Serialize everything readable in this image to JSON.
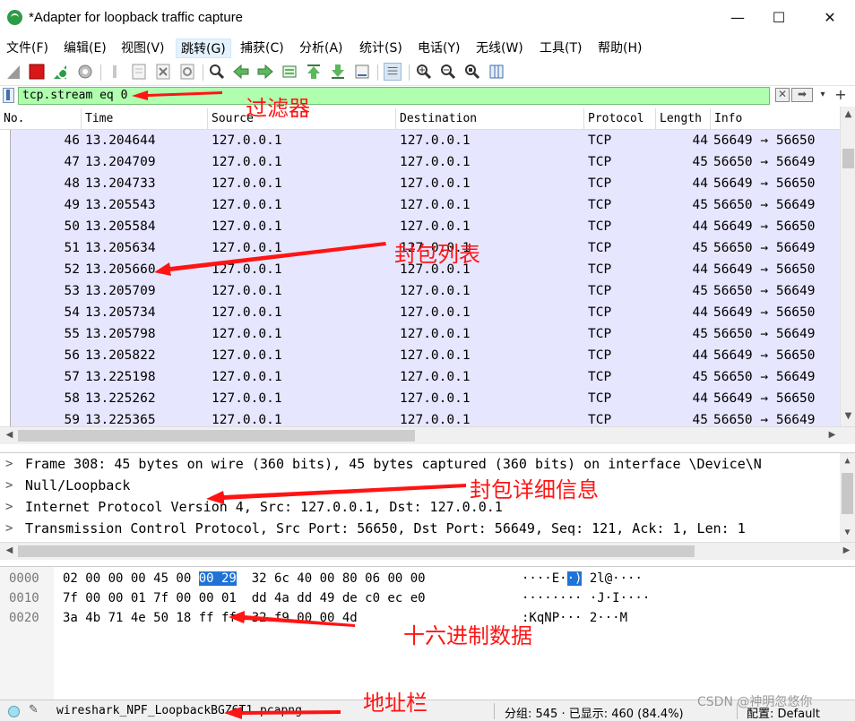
{
  "window": {
    "title": "*Adapter for loopback traffic capture",
    "controls": {
      "minimize": "—",
      "maximize": "☐",
      "close": "✕"
    }
  },
  "menu": {
    "items": [
      "文件(F)",
      "编辑(E)",
      "视图(V)",
      "跳转(G)",
      "捕获(C)",
      "分析(A)",
      "统计(S)",
      "电话(Y)",
      "无线(W)",
      "工具(T)",
      "帮助(H)"
    ],
    "active_index": 3
  },
  "filter": {
    "value": "tcp.stream eq 0",
    "background_color": "#afffaf"
  },
  "packet_list": {
    "columns": [
      "No.",
      "Time",
      "Source",
      "Destination",
      "Protocol",
      "Length",
      "Info"
    ],
    "rows": [
      {
        "no": "46",
        "time": "13.204644",
        "src": "127.0.0.1",
        "dst": "127.0.0.1",
        "proto": "TCP",
        "len": "44",
        "info": "56649 → 56650"
      },
      {
        "no": "47",
        "time": "13.204709",
        "src": "127.0.0.1",
        "dst": "127.0.0.1",
        "proto": "TCP",
        "len": "45",
        "info": "56650 → 56649"
      },
      {
        "no": "48",
        "time": "13.204733",
        "src": "127.0.0.1",
        "dst": "127.0.0.1",
        "proto": "TCP",
        "len": "44",
        "info": "56649 → 56650"
      },
      {
        "no": "49",
        "time": "13.205543",
        "src": "127.0.0.1",
        "dst": "127.0.0.1",
        "proto": "TCP",
        "len": "45",
        "info": "56650 → 56649"
      },
      {
        "no": "50",
        "time": "13.205584",
        "src": "127.0.0.1",
        "dst": "127.0.0.1",
        "proto": "TCP",
        "len": "44",
        "info": "56649 → 56650"
      },
      {
        "no": "51",
        "time": "13.205634",
        "src": "127.0.0.1",
        "dst": "127.0.0.1",
        "proto": "TCP",
        "len": "45",
        "info": "56650 → 56649"
      },
      {
        "no": "52",
        "time": "13.205660",
        "src": "127.0.0.1",
        "dst": "127.0.0.1",
        "proto": "TCP",
        "len": "44",
        "info": "56649 → 56650"
      },
      {
        "no": "53",
        "time": "13.205709",
        "src": "127.0.0.1",
        "dst": "127.0.0.1",
        "proto": "TCP",
        "len": "45",
        "info": "56650 → 56649"
      },
      {
        "no": "54",
        "time": "13.205734",
        "src": "127.0.0.1",
        "dst": "127.0.0.1",
        "proto": "TCP",
        "len": "44",
        "info": "56649 → 56650"
      },
      {
        "no": "55",
        "time": "13.205798",
        "src": "127.0.0.1",
        "dst": "127.0.0.1",
        "proto": "TCP",
        "len": "45",
        "info": "56650 → 56649"
      },
      {
        "no": "56",
        "time": "13.205822",
        "src": "127.0.0.1",
        "dst": "127.0.0.1",
        "proto": "TCP",
        "len": "44",
        "info": "56649 → 56650"
      },
      {
        "no": "57",
        "time": "13.225198",
        "src": "127.0.0.1",
        "dst": "127.0.0.1",
        "proto": "TCP",
        "len": "45",
        "info": "56650 → 56649"
      },
      {
        "no": "58",
        "time": "13.225262",
        "src": "127.0.0.1",
        "dst": "127.0.0.1",
        "proto": "TCP",
        "len": "44",
        "info": "56649 → 56650"
      },
      {
        "no": "59",
        "time": "13.225365",
        "src": "127.0.0.1",
        "dst": "127.0.0.1",
        "proto": "TCP",
        "len": "45",
        "info": "56650 → 56649"
      }
    ],
    "row_background": "#e7e6ff"
  },
  "details": [
    "Frame 308: 45 bytes on wire (360 bits), 45 bytes captured (360 bits) on interface \\Device\\N",
    "Null/Loopback",
    "Internet Protocol Version 4, Src: 127.0.0.1, Dst: 127.0.0.1",
    "Transmission Control Protocol, Src Port: 56650, Dst Port: 56649, Seq: 121, Ack: 1, Len: 1"
  ],
  "hex": {
    "rows": [
      {
        "offset": "0000",
        "bytes_a": "02 00 00 00 45 00 ",
        "bytes_hl": "00 29",
        "bytes_b": "  32 6c 40 00 80 06 00 00",
        "ascii_a": "····E·",
        "ascii_hl": "·)",
        "ascii_b": " 2l@····"
      },
      {
        "offset": "0010",
        "bytes_a": "7f 00 00 01 7f 00 00 01  dd 4a dd 49 de c0 ec e0",
        "bytes_hl": "",
        "bytes_b": "",
        "ascii_a": "········ ·J·I····",
        "ascii_hl": "",
        "ascii_b": ""
      },
      {
        "offset": "0020",
        "bytes_a": "3a 4b 71 4e 50 18 ff ff  32 f9 00 00 4d",
        "bytes_hl": "",
        "bytes_b": "",
        "ascii_a": ":KqNP··· 2···M",
        "ascii_hl": "",
        "ascii_b": ""
      }
    ],
    "highlight_color": "#1f73d7"
  },
  "status": {
    "file": "wireshark_NPF_LoopbackBGZ6T1.pcapng",
    "packets": "分组: 545 · 已显示: 460 (84.4%)",
    "profile": "配置: Default"
  },
  "annotations": {
    "filter_label": "过滤器",
    "packet_list_label": "封包列表",
    "details_label": "封包详细信息",
    "hex_label": "十六进制数据",
    "address_label": "地址栏",
    "color": "#ff1414"
  },
  "watermark": "CSDN @神明忽悠你",
  "icons": [
    "shark-fin-icon",
    "stop-icon",
    "restart-icon",
    "options-icon",
    "open-icon",
    "save-icon",
    "close-file-icon",
    "reload-icon",
    "find-icon",
    "back-icon",
    "forward-icon",
    "goto-icon",
    "first-icon",
    "last-icon",
    "autoscroll-icon",
    "colorize-icon",
    "zoom-in-icon",
    "zoom-out-icon",
    "zoom-reset-icon",
    "resize-columns-icon"
  ]
}
